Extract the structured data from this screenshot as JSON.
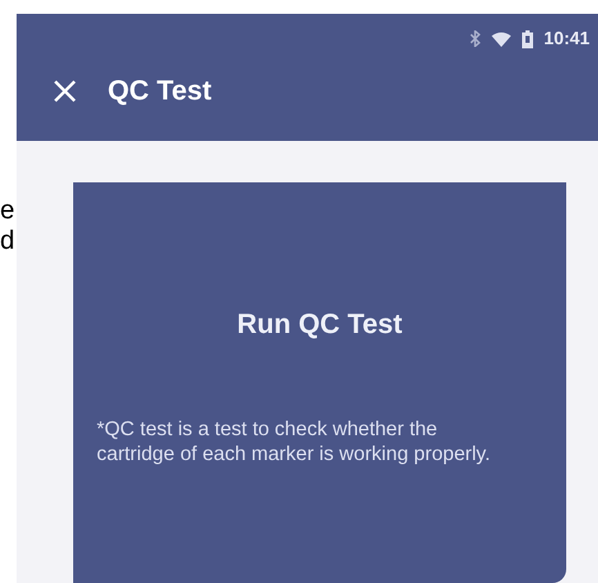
{
  "background_text": [
    "e",
    "d"
  ],
  "status_bar": {
    "time": "10:41"
  },
  "toolbar": {
    "title": "QC Test"
  },
  "card": {
    "title": "Run QC Test",
    "description": "*QC test is a test to check whether the cartridge of each marker is working properly."
  }
}
